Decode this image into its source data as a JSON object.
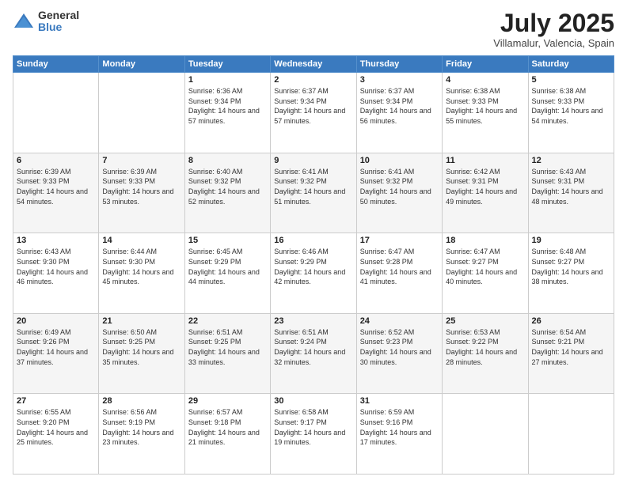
{
  "logo": {
    "general": "General",
    "blue": "Blue"
  },
  "title": {
    "month": "July 2025",
    "location": "Villamalur, Valencia, Spain"
  },
  "weekdays": [
    "Sunday",
    "Monday",
    "Tuesday",
    "Wednesday",
    "Thursday",
    "Friday",
    "Saturday"
  ],
  "weeks": [
    [
      null,
      null,
      {
        "day": "1",
        "sunrise": "6:36 AM",
        "sunset": "9:34 PM",
        "daylight": "14 hours and 57 minutes."
      },
      {
        "day": "2",
        "sunrise": "6:37 AM",
        "sunset": "9:34 PM",
        "daylight": "14 hours and 57 minutes."
      },
      {
        "day": "3",
        "sunrise": "6:37 AM",
        "sunset": "9:34 PM",
        "daylight": "14 hours and 56 minutes."
      },
      {
        "day": "4",
        "sunrise": "6:38 AM",
        "sunset": "9:33 PM",
        "daylight": "14 hours and 55 minutes."
      },
      {
        "day": "5",
        "sunrise": "6:38 AM",
        "sunset": "9:33 PM",
        "daylight": "14 hours and 54 minutes."
      }
    ],
    [
      {
        "day": "6",
        "sunrise": "6:39 AM",
        "sunset": "9:33 PM",
        "daylight": "14 hours and 54 minutes."
      },
      {
        "day": "7",
        "sunrise": "6:39 AM",
        "sunset": "9:33 PM",
        "daylight": "14 hours and 53 minutes."
      },
      {
        "day": "8",
        "sunrise": "6:40 AM",
        "sunset": "9:32 PM",
        "daylight": "14 hours and 52 minutes."
      },
      {
        "day": "9",
        "sunrise": "6:41 AM",
        "sunset": "9:32 PM",
        "daylight": "14 hours and 51 minutes."
      },
      {
        "day": "10",
        "sunrise": "6:41 AM",
        "sunset": "9:32 PM",
        "daylight": "14 hours and 50 minutes."
      },
      {
        "day": "11",
        "sunrise": "6:42 AM",
        "sunset": "9:31 PM",
        "daylight": "14 hours and 49 minutes."
      },
      {
        "day": "12",
        "sunrise": "6:43 AM",
        "sunset": "9:31 PM",
        "daylight": "14 hours and 48 minutes."
      }
    ],
    [
      {
        "day": "13",
        "sunrise": "6:43 AM",
        "sunset": "9:30 PM",
        "daylight": "14 hours and 46 minutes."
      },
      {
        "day": "14",
        "sunrise": "6:44 AM",
        "sunset": "9:30 PM",
        "daylight": "14 hours and 45 minutes."
      },
      {
        "day": "15",
        "sunrise": "6:45 AM",
        "sunset": "9:29 PM",
        "daylight": "14 hours and 44 minutes."
      },
      {
        "day": "16",
        "sunrise": "6:46 AM",
        "sunset": "9:29 PM",
        "daylight": "14 hours and 42 minutes."
      },
      {
        "day": "17",
        "sunrise": "6:47 AM",
        "sunset": "9:28 PM",
        "daylight": "14 hours and 41 minutes."
      },
      {
        "day": "18",
        "sunrise": "6:47 AM",
        "sunset": "9:27 PM",
        "daylight": "14 hours and 40 minutes."
      },
      {
        "day": "19",
        "sunrise": "6:48 AM",
        "sunset": "9:27 PM",
        "daylight": "14 hours and 38 minutes."
      }
    ],
    [
      {
        "day": "20",
        "sunrise": "6:49 AM",
        "sunset": "9:26 PM",
        "daylight": "14 hours and 37 minutes."
      },
      {
        "day": "21",
        "sunrise": "6:50 AM",
        "sunset": "9:25 PM",
        "daylight": "14 hours and 35 minutes."
      },
      {
        "day": "22",
        "sunrise": "6:51 AM",
        "sunset": "9:25 PM",
        "daylight": "14 hours and 33 minutes."
      },
      {
        "day": "23",
        "sunrise": "6:51 AM",
        "sunset": "9:24 PM",
        "daylight": "14 hours and 32 minutes."
      },
      {
        "day": "24",
        "sunrise": "6:52 AM",
        "sunset": "9:23 PM",
        "daylight": "14 hours and 30 minutes."
      },
      {
        "day": "25",
        "sunrise": "6:53 AM",
        "sunset": "9:22 PM",
        "daylight": "14 hours and 28 minutes."
      },
      {
        "day": "26",
        "sunrise": "6:54 AM",
        "sunset": "9:21 PM",
        "daylight": "14 hours and 27 minutes."
      }
    ],
    [
      {
        "day": "27",
        "sunrise": "6:55 AM",
        "sunset": "9:20 PM",
        "daylight": "14 hours and 25 minutes."
      },
      {
        "day": "28",
        "sunrise": "6:56 AM",
        "sunset": "9:19 PM",
        "daylight": "14 hours and 23 minutes."
      },
      {
        "day": "29",
        "sunrise": "6:57 AM",
        "sunset": "9:18 PM",
        "daylight": "14 hours and 21 minutes."
      },
      {
        "day": "30",
        "sunrise": "6:58 AM",
        "sunset": "9:17 PM",
        "daylight": "14 hours and 19 minutes."
      },
      {
        "day": "31",
        "sunrise": "6:59 AM",
        "sunset": "9:16 PM",
        "daylight": "14 hours and 17 minutes."
      },
      null,
      null
    ]
  ]
}
